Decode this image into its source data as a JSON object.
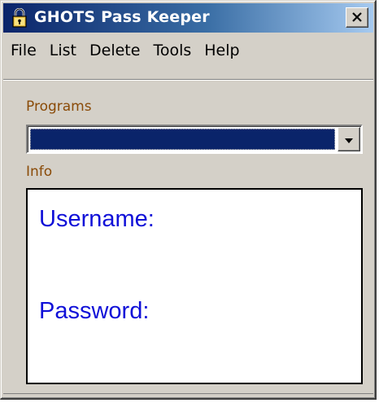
{
  "window": {
    "title": "GHOTS Pass Keeper",
    "title_icon": "padlock-icon",
    "close_icon": "close-icon"
  },
  "menu": {
    "items": [
      {
        "label": "File"
      },
      {
        "label": "List"
      },
      {
        "label": "Delete"
      },
      {
        "label": "Tools"
      },
      {
        "label": "Help"
      }
    ]
  },
  "programs": {
    "label": "Programs",
    "selected_value": "",
    "dropdown_icon": "chevron-down-icon"
  },
  "info": {
    "label": "Info",
    "username_label": "Username:",
    "password_label": "Password:"
  },
  "colors": {
    "titlebar_start": "#0a246a",
    "titlebar_end": "#a6caf0",
    "label_color": "#8a4b08",
    "info_text_color": "#1010d8",
    "selection_color": "#0a246a",
    "window_bg": "#d4d0c8"
  }
}
